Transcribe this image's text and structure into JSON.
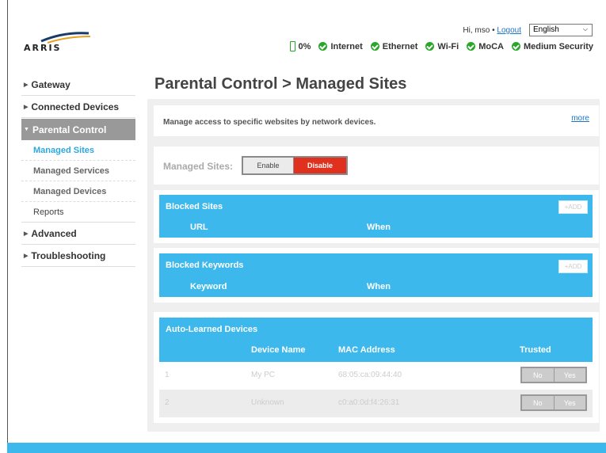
{
  "header": {
    "logo_text": "ARRIS",
    "greeting": "Hi, mso",
    "separator": "•",
    "logout": "Logout",
    "language": "English",
    "battery": "0%",
    "status": [
      "Internet",
      "Ethernet",
      "Wi-Fi",
      "MoCA",
      "Medium Security"
    ]
  },
  "sidebar": {
    "items": [
      {
        "label": "Gateway"
      },
      {
        "label": "Connected Devices"
      },
      {
        "label": "Parental Control"
      },
      {
        "label": "Advanced"
      },
      {
        "label": "Troubleshooting"
      }
    ],
    "sub_items": [
      {
        "label": "Managed Sites"
      },
      {
        "label": "Managed Services"
      },
      {
        "label": "Managed Devices"
      },
      {
        "label": "Reports"
      }
    ]
  },
  "main": {
    "title": "Parental Control > Managed Sites",
    "description": "Manage access to specific websites by network devices.",
    "more": "more",
    "managed_sites_label": "Managed Sites:",
    "enable": "Enable",
    "disable": "Disable",
    "blocked_sites": {
      "title": "Blocked Sites",
      "add": "+ADD",
      "col_url": "URL",
      "col_when": "When"
    },
    "blocked_keywords": {
      "title": "Blocked Keywords",
      "add": "+ADD",
      "col_keyword": "Keyword",
      "col_when": "When"
    },
    "auto_learned": {
      "title": "Auto-Learned Devices",
      "col_device": "Device Name",
      "col_mac": "MAC Address",
      "col_trusted": "Trusted",
      "rows": [
        {
          "num": "1",
          "name": "My PC",
          "mac": "68:05:ca:09:44:40",
          "no": "No",
          "yes": "Yes"
        },
        {
          "num": "2",
          "name": "Unknown",
          "mac": "c0:a0:0d:f4:26:31",
          "no": "No",
          "yes": "Yes"
        }
      ]
    }
  },
  "colors": {
    "accent": "#3db8ec",
    "disable": "#e0301e",
    "ok": "#2aa62a",
    "link": "#1a75cf"
  }
}
